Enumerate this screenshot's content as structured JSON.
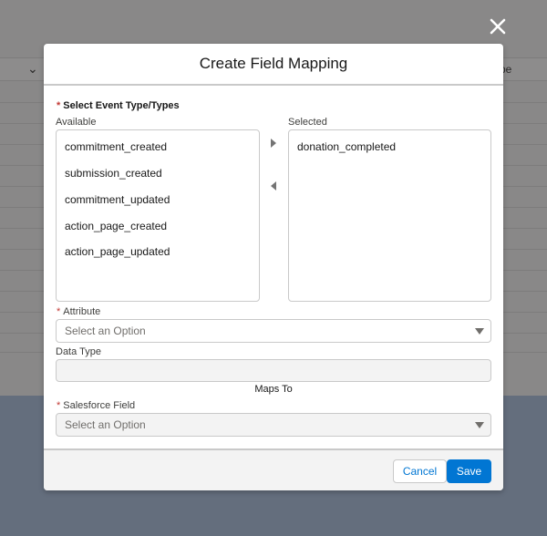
{
  "background": {
    "header_partial_text": "pe"
  },
  "modal": {
    "title": "Create Field Mapping",
    "event_types": {
      "label": "Select Event Type/Types",
      "required_marker": "*",
      "available_label": "Available",
      "selected_label": "Selected",
      "available_items": [
        "commitment_created",
        "submission_created",
        "commitment_updated",
        "action_page_created",
        "action_page_updated"
      ],
      "selected_items": [
        "donation_completed"
      ]
    },
    "attribute": {
      "label": "Attribute",
      "required_marker": "*",
      "placeholder": "Select an Option"
    },
    "data_type": {
      "label": "Data Type",
      "value": ""
    },
    "maps_to": "Maps To",
    "salesforce_field": {
      "label": "Salesforce Field",
      "required_marker": "*",
      "placeholder": "Select an Option"
    },
    "footer": {
      "cancel_label": "Cancel",
      "save_label": "Save"
    }
  },
  "colors": {
    "brand": "#0176d3",
    "required": "#c23934",
    "border": "#c9c9c9"
  },
  "icons": {
    "close": "close-icon",
    "move_right": "move-right-arrow-icon",
    "move_left": "move-left-arrow-icon",
    "dropdown": "chevron-down-icon"
  }
}
